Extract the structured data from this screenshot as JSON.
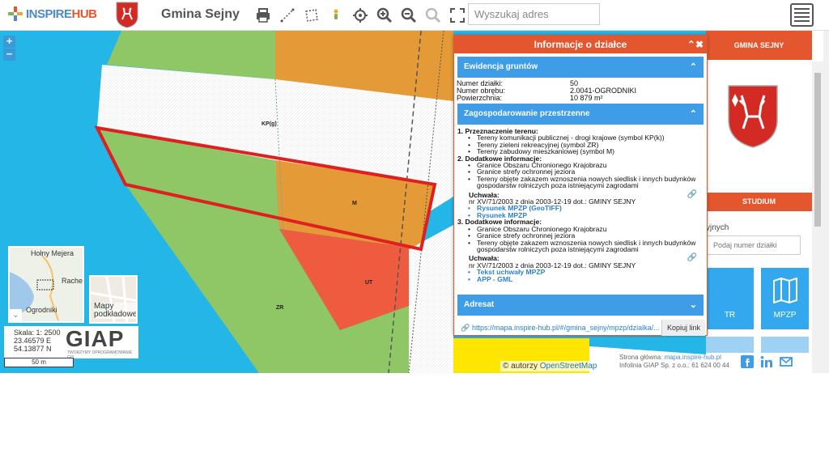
{
  "header": {
    "brand_part1": "INSPIRE",
    "brand_part2": "HUB",
    "org_name": "Gmina Sejny",
    "search_placeholder": "Wyszukaj adres",
    "tools": [
      "print-icon",
      "measure-line-icon",
      "measure-area-icon",
      "street-view-icon",
      "locate-icon",
      "zoom-in-icon",
      "zoom-out-icon",
      "zoom-extent-icon",
      "fullscreen-icon"
    ]
  },
  "map": {
    "zoom_in": "+",
    "zoom_out": "−",
    "labels": {
      "kpg": "KP(g)",
      "m": "M",
      "ut": "UT",
      "zr": "ZR"
    },
    "minimap": {
      "label1": "Hołny Mejera",
      "label2": "Rache",
      "label3": "Ogrodniki"
    },
    "basemap_label": "Mapy podkładowe",
    "scale_text": "Skala: 1: 2500",
    "coord_e": "23.46579 E",
    "coord_n": "54.13877 N",
    "giap": "GIAP",
    "giap_sub": "TWORZYMY OPROGRAMOWANIE GIS",
    "scalebar": "50 m",
    "attribution_prefix": "© autorzy",
    "attribution_link": "OpenStreetMap"
  },
  "popup": {
    "title": "Informacje o działce",
    "ewidencja": {
      "title": "Ewidencja gruntów",
      "rows": [
        {
          "k": "Numer działki:",
          "v": "50"
        },
        {
          "k": "Numer obrębu:",
          "v": "2.0041-OGRODNIKI"
        },
        {
          "k": "Powierzchnia:",
          "v": "10 879 m²"
        }
      ]
    },
    "zagospodarowanie": {
      "title": "Zagospodarowanie przestrzenne",
      "item1_head": "1.  Przeznaczenie terenu:",
      "item1_bullets": [
        "Tereny komunikacji publicznej - drogi krajowe (symbol KP(k))",
        "Tereny zieleni rekreacyjnej (symbol ZR)",
        "Tereny zabudowy mieszkaniowej (symbol M)"
      ],
      "item2_head": "2.  Dodatkowe informacje:",
      "item2_bullets": [
        "Granice Obszaru Chronionego Krajobrazu",
        "Granice strefy ochronnej jeziora",
        "Tereny objęte zakazem wznoszenia nowych siedlisk i innych budynków gospodarstw rolniczych poza istniejącymi zagrodami"
      ],
      "uchwala_label": "Uchwała:",
      "uchwala1_text": "nr XV/71/2003 z dnia 2003-12-19 dot.: GMINY SEJNY",
      "uchwala1_links": [
        "Rysunek MPZP (GeoTIFF)",
        "Rysunek MPZP"
      ],
      "item3_head": "3.  Dodatkowe informacje:",
      "item3_bullets": [
        "Granice Obszaru Chronionego Krajobrazu",
        "Granice strefy ochronnej jeziora",
        "Tereny objęte zakazem wznoszenia nowych siedlisk i innych budynków gospodarstw rolniczych poza istniejącymi zagrodami"
      ],
      "uchwala2_text": "nr XV/71/2003 z dnia 2003-12-19 dot.: GMINY SEJNY",
      "uchwala2_links": [
        "Tekst uchwały MPZP",
        "APP - GML"
      ]
    },
    "adresat": {
      "title": "Adresat"
    },
    "link_url": "https://mapa.inspire-hub.pl/#/gmina_sejny/mpzp/dzialka/...",
    "copy_label": "Kopiuj link"
  },
  "side": {
    "title": "GMINA SEJNY",
    "studium": "STUDIUM",
    "label_partial": "yjnych",
    "parcel_placeholder": "Podaj numer działki",
    "tile1_label": "TR",
    "tile2_label": "MPZP",
    "footer_line1_prefix": "Strona główna:",
    "footer_line1_link": "mapa.inspire-hub.pl",
    "footer_line2": "Infolinia GIAP Sp. z o.o.: 61 624 00 44"
  },
  "colors": {
    "accent": "#e4572e",
    "blue": "#3e9de6",
    "water": "#25b6e8",
    "green": "#8fc766",
    "orange": "#e39a37",
    "red": "#ee5b3f",
    "yellow": "#ffe600",
    "parcel_outline": "#e02020"
  }
}
